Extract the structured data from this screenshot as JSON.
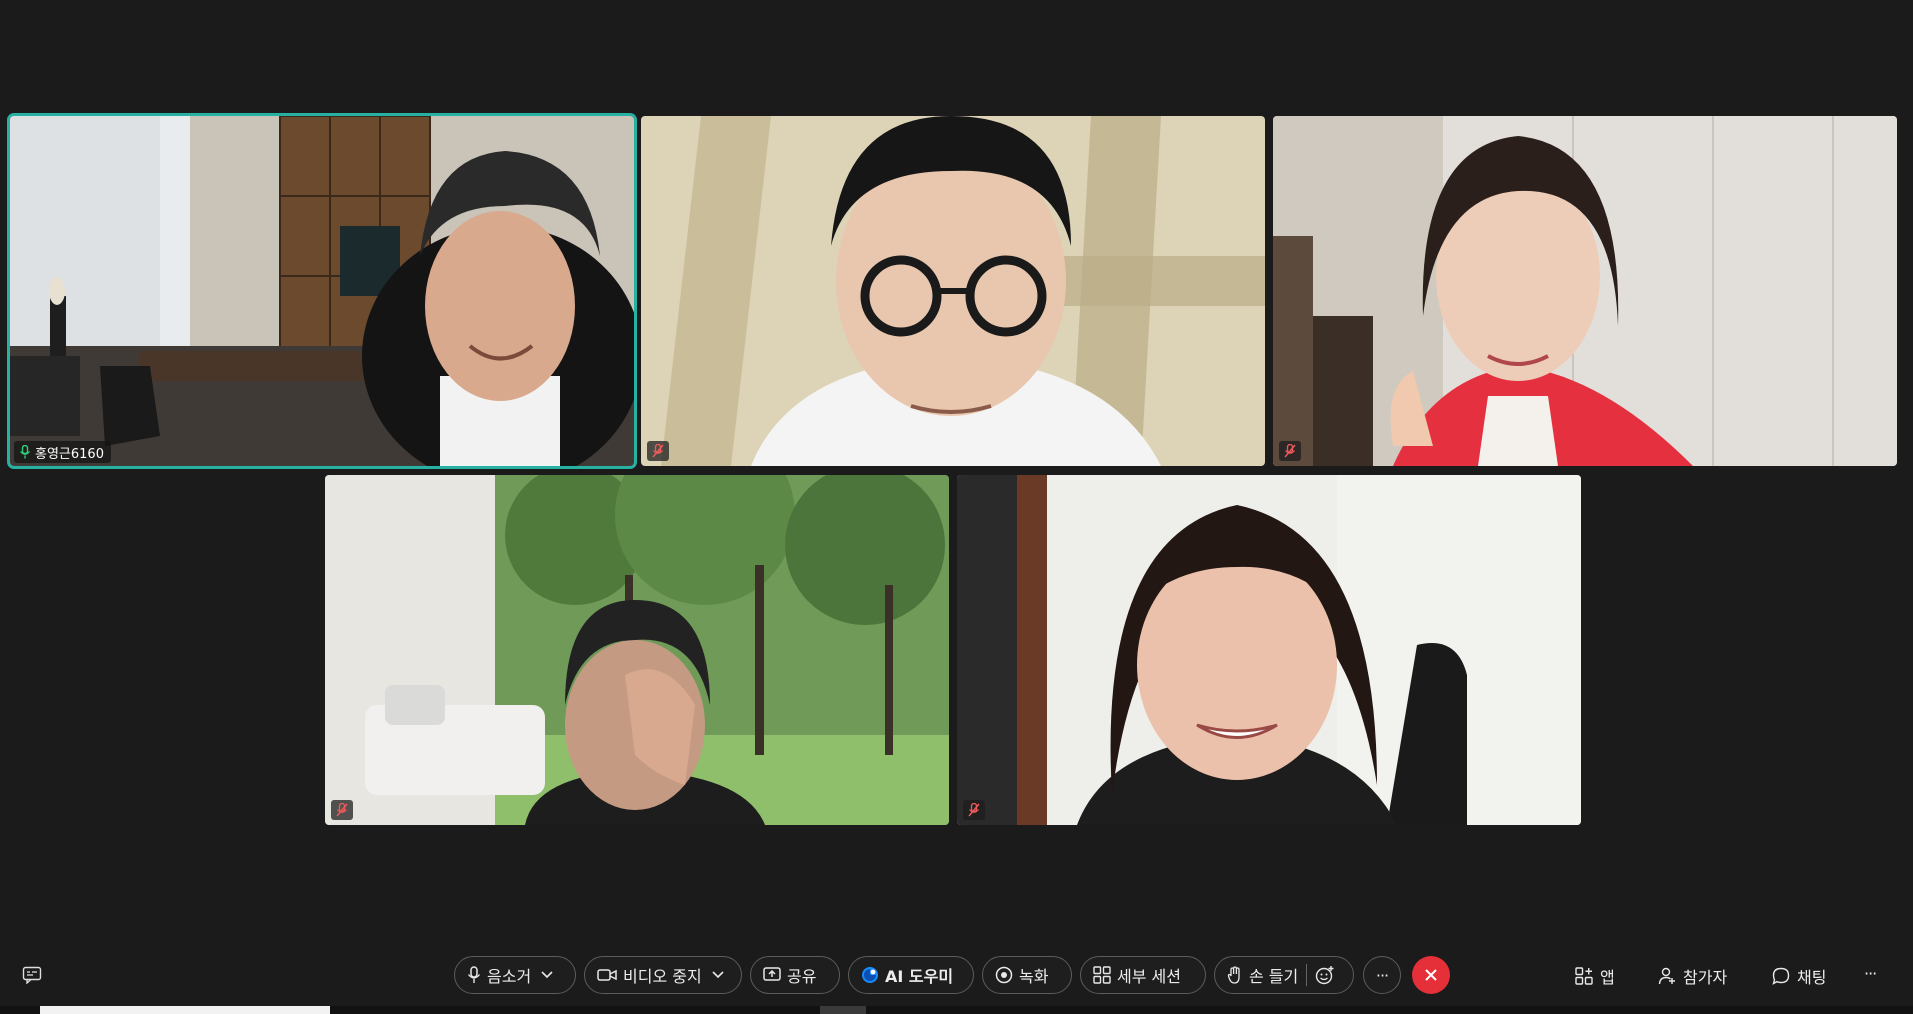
{
  "participants": [
    {
      "name": "홍영근6160",
      "muted": false,
      "active": true
    },
    {
      "name": "",
      "muted": true,
      "active": false
    },
    {
      "name": "",
      "muted": true,
      "active": false
    },
    {
      "name": "",
      "muted": true,
      "active": false
    },
    {
      "name": "",
      "muted": true,
      "active": false
    }
  ],
  "toolbar": {
    "mute_label": "음소거",
    "video_label": "비디오 중지",
    "share_label": "공유",
    "ai_label": "AI 도우미",
    "record_label": "녹화",
    "breakout_label": "세부 세션",
    "raise_hand_label": "손 들기",
    "more_label": "···",
    "apps_label": "앱",
    "participants_label": "참가자",
    "chat_label": "채팅",
    "right_more_label": "···"
  },
  "colors": {
    "background": "#1b1b1b",
    "active_speaker_border": "#26b1a2",
    "end_call": "#e5303a",
    "ai_accent": "#1a8cff"
  }
}
